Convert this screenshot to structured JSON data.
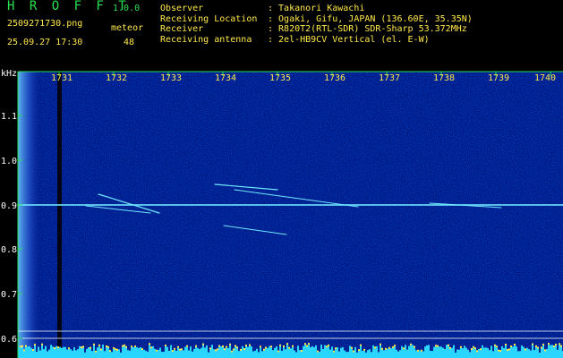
{
  "header": {
    "app_title": "H R O F F T",
    "app_version": "1.0.0",
    "file_name": "2509271730.png",
    "meteor_label": "meteor",
    "datetime": "25.09.27 17:30",
    "meteor_count": "48",
    "info": [
      {
        "label": "Observer",
        "value": ": Takanori Kawachi"
      },
      {
        "label": "Receiving Location",
        "value": ": Ogaki, Gifu, JAPAN (136.60E, 35.35N)"
      },
      {
        "label": "Receiver",
        "value": ": R820T2(RTL-SDR) SDR-Sharp 53.372MHz"
      },
      {
        "label": "Receiving antenna",
        "value": ": 2el-HB9CV Vertical (el. E-W)"
      }
    ]
  },
  "spectrogram": {
    "y_unit": "kHz",
    "time_ticks": [
      "1731",
      "1732",
      "1733",
      "1734",
      "1735",
      "1736",
      "1737",
      "1738",
      "1739",
      "1740"
    ],
    "freq_ticks": [
      "1.1",
      "1.0",
      "0.9",
      "0.8",
      "0.7",
      "0.6"
    ],
    "colors": {
      "axis": "#27e04f",
      "time_label": "#ffe84a",
      "noise_bg": "#000c6e",
      "trace": "#6fe8ff",
      "bottom_bar": "#2ad6ff",
      "bottom_bar_peak": "#ffe84a"
    }
  }
}
